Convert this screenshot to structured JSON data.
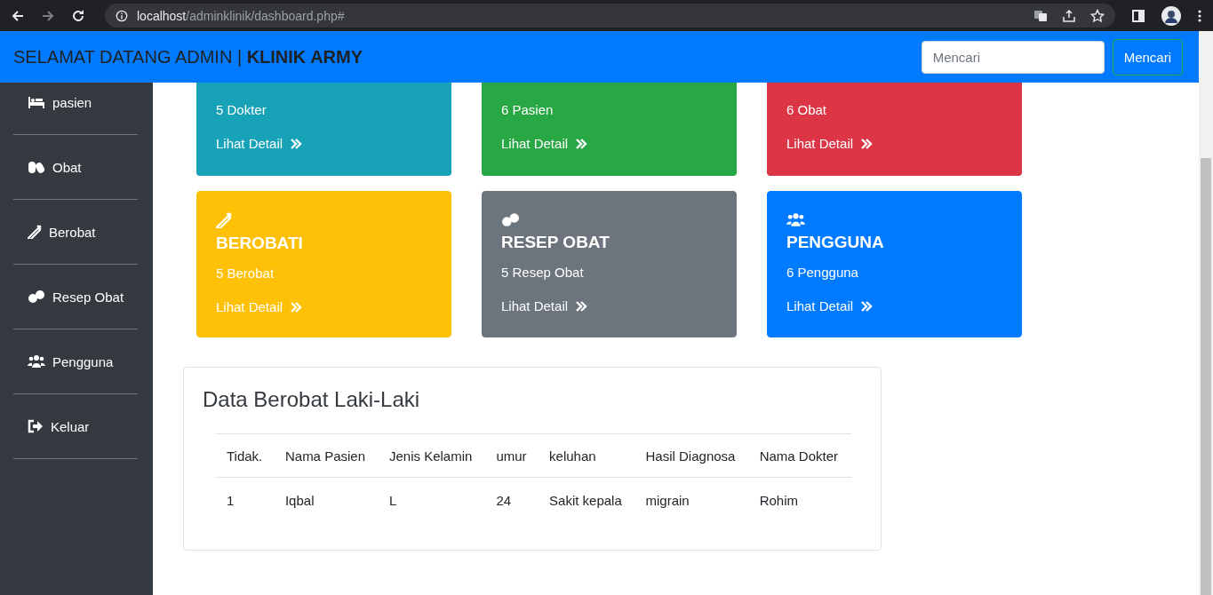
{
  "browser": {
    "url_host": "localhost",
    "url_path": "/adminklinik/dashboard.php#"
  },
  "navbar": {
    "brand": "SELAMAT DATANG ADMIN | **KLINIK ARMY**",
    "search": {
      "placeholder": "Mencari"
    },
    "search_button": "Mencari"
  },
  "sidebar": {
    "items": [
      {
        "label": "pasien",
        "kind": "bed"
      },
      {
        "label": "Obat",
        "kind": "capsules"
      },
      {
        "label": "Berobat",
        "kind": "syringe"
      },
      {
        "label": "Resep Obat",
        "kind": "tablets"
      },
      {
        "label": "Pengguna",
        "kind": "users"
      },
      {
        "label": "Keluar",
        "kind": "logout"
      }
    ]
  },
  "cards": [
    {
      "count": "5 Dokter",
      "link": "Lihat Detail",
      "color": "#17a2b8"
    },
    {
      "count": "6 Pasien",
      "link": "Lihat Detail",
      "color": "#28a745"
    },
    {
      "count": "6 Obat",
      "link": "Lihat Detail",
      "color": "#dc3545"
    },
    {
      "kind": "syringe",
      "title": "BEROBATI",
      "count": "5 Berobat",
      "link": "Lihat Detail",
      "color": "#ffc107"
    },
    {
      "kind": "tablets",
      "title": "RESEP OBAT",
      "count": "5 Resep Obat",
      "link": "Lihat Detail",
      "color": "#6c757d"
    },
    {
      "kind": "users",
      "title": "PENGGUNA",
      "count": "6 Pengguna",
      "link": "Lihat Detail",
      "color": "#007bff"
    }
  ],
  "table": {
    "title": "Data Berobat Laki-Laki",
    "columns": [
      "Tidak.",
      "Nama Pasien",
      "Jenis Kelamin",
      "umur",
      "keluhan",
      "Hasil Diagnosa",
      "Nama Dokter"
    ],
    "rows": [
      [
        "1",
        "Iqbal",
        "L",
        "24",
        "Sakit kepala",
        "migrain",
        "Rohim"
      ]
    ]
  }
}
